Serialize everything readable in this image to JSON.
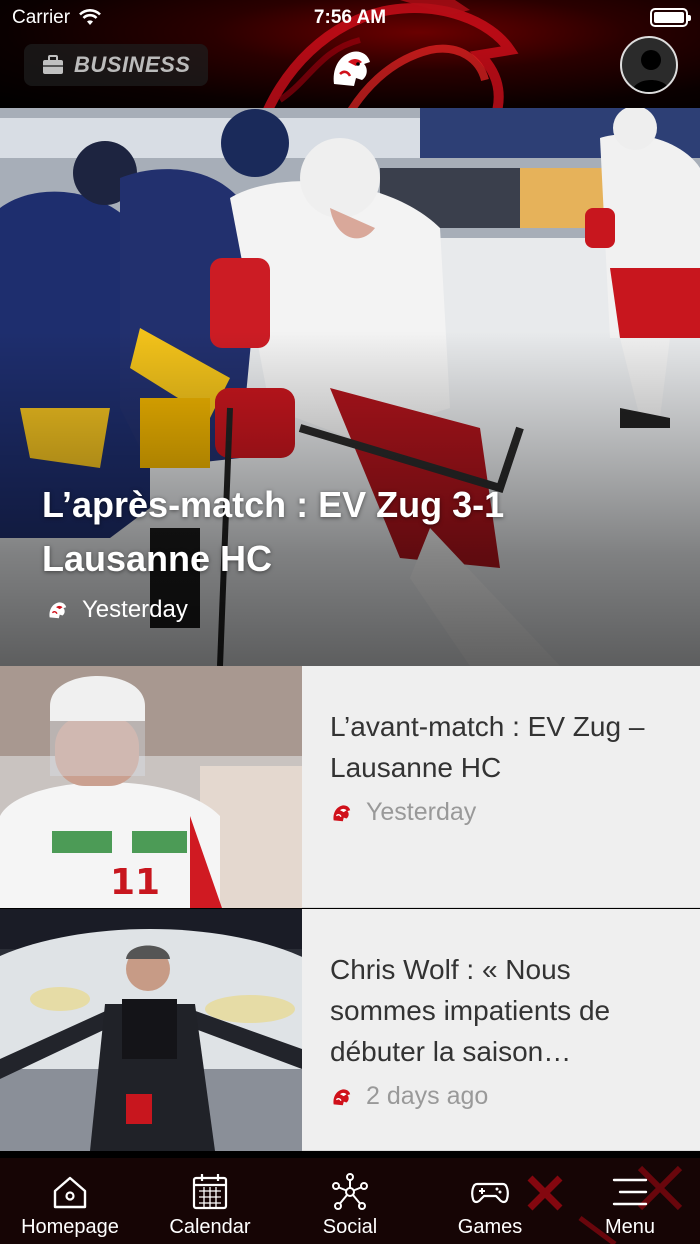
{
  "status_bar": {
    "carrier": "Carrier",
    "time": "7:56 AM"
  },
  "header": {
    "business_label": "BUSINESS",
    "accent": "#d0101a"
  },
  "hero": {
    "title": "L’après-match : EV Zug 3-1 Lausanne HC",
    "time": "Yesterday"
  },
  "articles": [
    {
      "title": "L’avant-match : EV Zug – Lausanne HC",
      "time": "Yesterday"
    },
    {
      "title": "Chris Wolf : « Nous sommes impatients de débuter la saison…",
      "time": "2 days ago"
    }
  ],
  "tabs": [
    {
      "label": "Homepage",
      "icon": "home-icon"
    },
    {
      "label": "Calendar",
      "icon": "calendar-icon"
    },
    {
      "label": "Social",
      "icon": "social-network-icon"
    },
    {
      "label": "Games",
      "icon": "gamepad-icon"
    },
    {
      "label": "Menu",
      "icon": "hamburger-menu-icon"
    }
  ]
}
